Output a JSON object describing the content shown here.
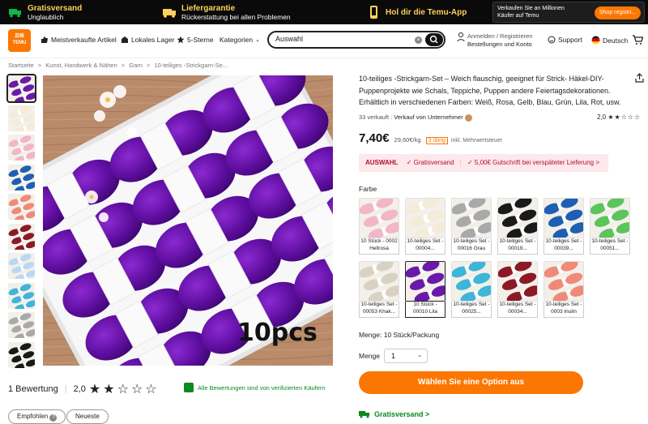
{
  "topbar": {
    "free_shipping_title": "Gratisversand",
    "free_shipping_sub": "Unglaublich",
    "guarantee_title": "Liefergarantie",
    "guarantee_sub": "Rückerstattung bei allen Problemen",
    "app_label": "Hol dir die Temu-App",
    "promo_text_1": "Verkaufen Sie an Millionen",
    "promo_text_2": "Käufer auf Temu",
    "promo_button": "Shop registri..."
  },
  "header": {
    "logo_text_1": "吕咏",
    "logo_text_2": "TEMU",
    "nav": [
      "Meistverkaufte Artikel",
      "Lokales Lager",
      "5-Sterne",
      "Kategorien"
    ],
    "search_value": "Auswahl",
    "account_line1": "Anmelden / Registrieren",
    "account_line2": "Bestellungen und Konto",
    "support": "Support",
    "language": "Deutsch"
  },
  "breadcrumb": [
    "Startseite",
    ">",
    "Kunst, Handwerk & Nähen",
    ">",
    "Garn",
    ">",
    "10-teiliges -Strickgarn-Se..."
  ],
  "main_image": {
    "caption": "10pcs"
  },
  "reviews": {
    "count_label": "1 Bewertung",
    "score": "2,0",
    "stars_filled": 2,
    "stars_total": 5,
    "verified_text": "Alle Bewertungen sind von verifizierten Käufern",
    "chips": [
      "Empfohlen",
      "Neueste"
    ]
  },
  "product": {
    "title": "10-teiliges -Strickgarn-Set – Weich flauschig, geeignet für Strick- Häkel-DIY-Puppenprojekte wie Schals, Teppiche, Puppen andere Feiertagsdekorationen. Erhältlich in verschiedenen Farben: Weiß, Rosa, Gelb, Blau, Grün, Lila, Rot, usw.",
    "sold": "33 verkauft",
    "seller": "Verkauf von Unternehmer",
    "rating": "2,0",
    "price": "7,40€",
    "unit_price": "29,60€/kg",
    "stock_badge": "3 übrig",
    "tax_note": "inkl. Mehrwertsteuer"
  },
  "banner": {
    "lead": "AUSWAHL",
    "items": [
      "✓ Gratisversand",
      "|",
      "✓ 5,00€ Gutschrift bei verspäteter Lieferung >"
    ]
  },
  "colors": {
    "label": "Farbe",
    "options": [
      {
        "caption": "10 Stück - 0002 Hellrosa",
        "swatch": "#f2b6c6"
      },
      {
        "caption": "10-teiliges Set - 00004...",
        "swatch": "#f4ecd8"
      },
      {
        "caption": "10-teiliges Set - 00016 Grau",
        "swatch": "#a9a9a9"
      },
      {
        "caption": "10-teiliges Set - 00019...",
        "swatch": "#1a1a1a"
      },
      {
        "caption": "10-teiliges Set - 00039...",
        "swatch": "#1e5fb3"
      },
      {
        "caption": "10-teiliges Set - 00051...",
        "swatch": "#5cc45c"
      },
      {
        "caption": "10-teiliges Set - 00053 Khak...",
        "swatch": "#d9d2c2"
      },
      {
        "caption": "10 Stück - 00010 Lila",
        "swatch": "#6a1aa8"
      },
      {
        "caption": "10-teiliges Set - 00025...",
        "swatch": "#3fb5d8"
      },
      {
        "caption": "10-teiliges Set - 00034...",
        "swatch": "#8c1a26"
      },
      {
        "caption": "10-teiliges Set - 0003 Inulin",
        "swatch": "#f08a78"
      }
    ]
  },
  "menge_label": "Menge: 10 Stück/Packung",
  "quantity": {
    "label": "Menge",
    "value": "1"
  },
  "cta": "Wählen Sie eine Option aus",
  "shipping": "Gratisversand >",
  "thumbnails": [
    "#6a1aa8",
    "#f4ecd8",
    "#f2b6c6",
    "#1e5fb3",
    "#f08a78",
    "#8c1a26",
    "#b9d9f2",
    "#3fb5d8",
    "#a9a9a9",
    "#1a1a1a"
  ]
}
